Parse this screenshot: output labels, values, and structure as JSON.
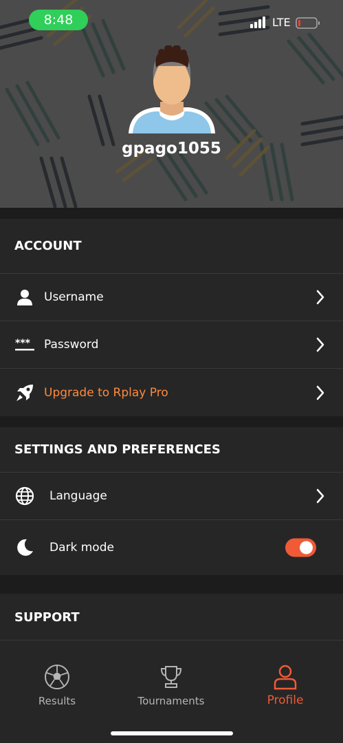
{
  "status_bar": {
    "time": "8:48",
    "network": "LTE"
  },
  "profile": {
    "username": "gpago1055"
  },
  "account": {
    "title": "ACCOUNT",
    "items": [
      {
        "label": "Username",
        "icon": "person-icon"
      },
      {
        "label": "Password",
        "icon": "password-icon"
      },
      {
        "label": "Upgrade to Rplay Pro",
        "icon": "rocket-icon"
      }
    ]
  },
  "settings": {
    "title": "SETTINGS AND PREFERENCES",
    "items": [
      {
        "label": "Language",
        "icon": "globe-icon"
      },
      {
        "label": "Dark mode",
        "icon": "moon-icon",
        "enabled": true
      }
    ]
  },
  "support": {
    "title": "SUPPORT"
  },
  "nav": {
    "items": [
      {
        "label": "Results",
        "icon": "soccer-ball-icon"
      },
      {
        "label": "Tournaments",
        "icon": "trophy-icon"
      },
      {
        "label": "Profile",
        "icon": "profile-icon",
        "active": true
      }
    ]
  },
  "colors": {
    "accent": "#f05a36",
    "upgrade_text": "#ff8a3d",
    "section_bg": "#262626",
    "page_bg": "#1c1c1c"
  }
}
